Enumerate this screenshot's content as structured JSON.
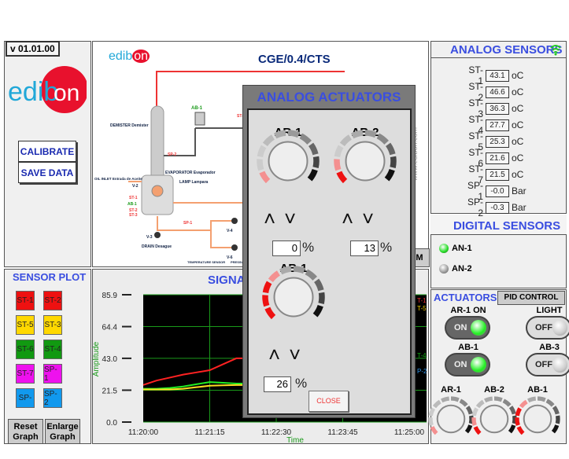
{
  "version": "v 01.01.00",
  "logo_text": "edibon",
  "buttons": {
    "calibrate": "CALIBRATE",
    "save_data": "SAVE DATA",
    "reset_graph": "Reset Graph",
    "enlarge_graph": "Enlarge Graph",
    "close": "CLOSE",
    "partial_m": "M"
  },
  "diagram": {
    "title": "CGE/0.4/CTS",
    "labels": [
      "ST-6",
      "AB-1",
      "DEMISTER Demister",
      "SP-2",
      "EVAPORATOR Evaporador",
      "OIL INLET Entrada de Aceite",
      "V-2",
      "LAMP Lampara",
      "ST-1",
      "AB-1",
      "ST-2",
      "ST-3",
      "SP-1",
      "V-3",
      "DRAIN Desague",
      "V-4",
      "V-6",
      "TEMPERATURE SENSOR",
      "PRESSURE SENSOR"
    ],
    "watermark": "www.edibon.com"
  },
  "analog_sensors": {
    "title": "ANALOG SENSORS",
    "icon": "wifi-icon",
    "items": [
      {
        "label": "ST-1",
        "value": "43.1",
        "unit": "oC"
      },
      {
        "label": "ST-2",
        "value": "46.6",
        "unit": "oC"
      },
      {
        "label": "ST-3",
        "value": "36.3",
        "unit": "oC"
      },
      {
        "label": "ST-4",
        "value": "27.7",
        "unit": "oC"
      },
      {
        "label": "ST-5",
        "value": "25.3",
        "unit": "oC"
      },
      {
        "label": "ST-6",
        "value": "21.6",
        "unit": "oC"
      },
      {
        "label": "ST-7",
        "value": "21.5",
        "unit": "oC"
      },
      {
        "label": "SP-1",
        "value": "-0.0",
        "unit": "Bar"
      },
      {
        "label": "SP-2",
        "value": "-0.3",
        "unit": "Bar"
      }
    ]
  },
  "digital_sensors": {
    "title": "DIGITAL SENSORS",
    "items": [
      {
        "label": "AN-1",
        "state": "on",
        "color": "#22dd22"
      },
      {
        "label": "AN-2",
        "state": "off",
        "color": "#999999"
      }
    ]
  },
  "actuators": {
    "tab_active": "ACTUATORS",
    "tab_pid": "PID CONTROL",
    "switches": [
      {
        "label": "AR-1 ON",
        "state": "ON",
        "on": true
      },
      {
        "label": "LIGHT",
        "state": "OFF",
        "on": false
      },
      {
        "label": "AB-1",
        "state": "ON",
        "on": true
      },
      {
        "label": "AB-3",
        "state": "OFF",
        "on": false
      }
    ],
    "knobs": [
      {
        "label": "AR-1",
        "percent": 0
      },
      {
        "label": "AB-2",
        "percent": 13
      },
      {
        "label": "AB-1",
        "percent": 26
      }
    ]
  },
  "sensor_plot": {
    "title": "SENSOR PLOT",
    "items": [
      {
        "label": "ST-1",
        "color": "#ee1111"
      },
      {
        "label": "ST-2",
        "color": "#ee1111"
      },
      {
        "label": "ST-5",
        "color": "#ffd800"
      },
      {
        "label": "ST-3",
        "color": "#ffd800"
      },
      {
        "label": "ST-6",
        "color": "#119911"
      },
      {
        "label": "ST-4",
        "color": "#119911"
      },
      {
        "label": "ST-7",
        "color": "#ee11ee"
      },
      {
        "label": "SP-1",
        "color": "#ee11ee"
      },
      {
        "label": "SP-",
        "color": "#1199ee"
      },
      {
        "label": "SP-2",
        "color": "#1199ee"
      }
    ]
  },
  "legend_partial": [
    {
      "label": "T-1",
      "color": "#ee3333"
    },
    {
      "label": "T-5",
      "color": "#eecc00"
    },
    {
      "label": "T-4",
      "color": "#11aa11"
    },
    {
      "label": "P-2",
      "color": "#3399ee"
    }
  ],
  "modal": {
    "title": "ANALOG ACTUATORS",
    "knobs": [
      {
        "label": "AR-1",
        "percent": 0
      },
      {
        "label": "AB-2",
        "percent": 13
      },
      {
        "label": "AB-1",
        "percent": 26
      }
    ],
    "unit": "%"
  },
  "chart_data": {
    "type": "line",
    "title": "SIGNAL",
    "xlabel": "Time",
    "ylabel": "Amplitude",
    "ylim": [
      0,
      85.9
    ],
    "yticks": [
      "85.9",
      "64.4",
      "43.0",
      "21.5",
      "0.0"
    ],
    "xticks": [
      "11:20:00",
      "11:21:15",
      "11:22:30",
      "11:23:45",
      "11:25:00"
    ],
    "grid": true,
    "background": "#000000",
    "x": [
      "11:20:00",
      "11:20:15",
      "11:20:30",
      "11:20:45",
      "11:21:00",
      "11:21:15",
      "11:21:30",
      "11:21:45",
      "11:22:00"
    ],
    "series": [
      {
        "color": "#ff2222",
        "values": [
          25,
          28,
          30,
          32,
          33.5,
          35,
          39,
          43,
          43
        ]
      },
      {
        "color": "#22ee22",
        "values": [
          22.5,
          22.5,
          23,
          24,
          25.5,
          27,
          26.5,
          26,
          26
        ]
      },
      {
        "color": "#ffdd22",
        "values": [
          22,
          22,
          22,
          22.5,
          23.5,
          24.5,
          24.8,
          25,
          25
        ]
      }
    ]
  }
}
